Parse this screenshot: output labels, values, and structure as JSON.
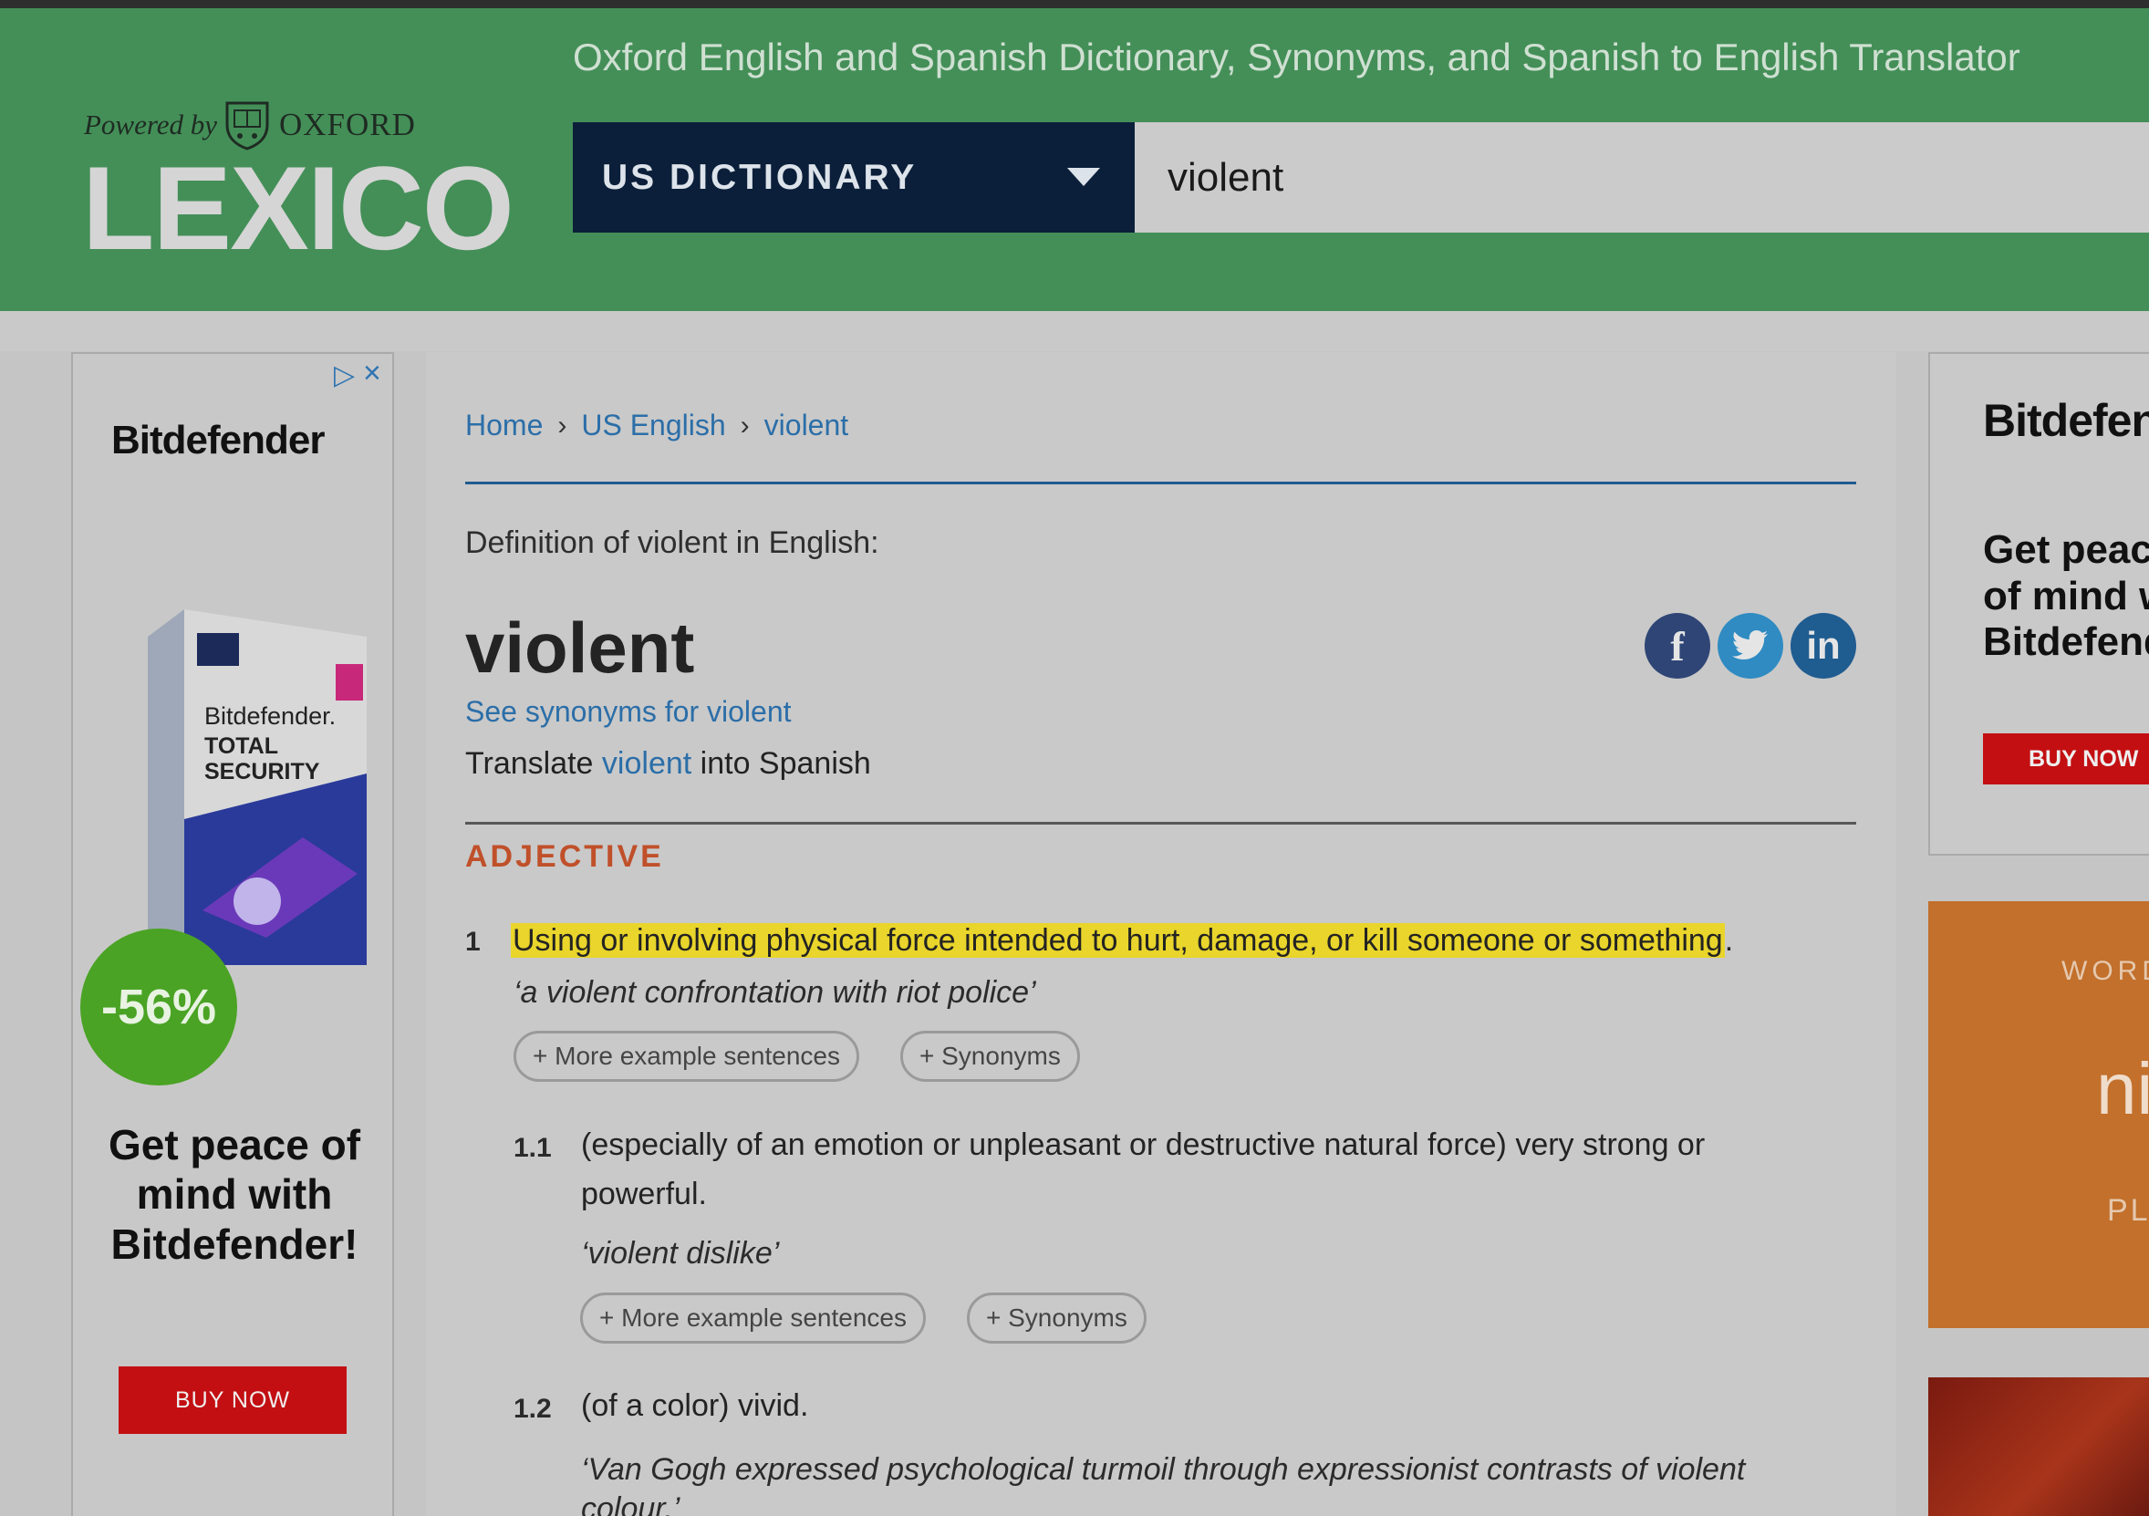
{
  "header": {
    "tagline": "Oxford English and Spanish Dictionary, Synonyms, and Spanish to English Translator",
    "powered_by": "Powered by",
    "oxford": "OXFORD",
    "logo": "LEXICO",
    "dictionary_select": "US DICTIONARY",
    "search_value": "violent"
  },
  "left_ad": {
    "brand": "Bitdefender",
    "discount": "-56%",
    "headline": "Get peace of mind with Bitdefender!",
    "button": "BUY NOW"
  },
  "breadcrumb": {
    "home": "Home",
    "section": "US English",
    "current": "violent"
  },
  "entry": {
    "definition_of": "Definition of violent in English:",
    "headword": "violent",
    "see_synonyms": "See synonyms for violent",
    "translate_prefix": "Translate",
    "translate_word": "violent",
    "translate_suffix": "into Spanish",
    "part_of_speech": "ADJECTIVE",
    "senses": [
      {
        "num": "1",
        "definition": "Using or involving physical force intended to hurt, damage, or kill someone or something",
        "example": "‘a violent confrontation with riot police’",
        "more_examples": "+ More example sentences",
        "synonyms": "+ Synonyms"
      },
      {
        "num": "1.1",
        "definition": "(especially of an emotion or unpleasant or destructive natural force) very strong or powerful.",
        "example": "‘violent dislike’",
        "more_examples": "+ More example sentences",
        "synonyms": "+ Synonyms"
      },
      {
        "num": "1.2",
        "definition": "(of a color) vivid.",
        "example": "‘Van Gogh expressed psychological turmoil through expressionist contrasts of violent colour.’"
      }
    ]
  },
  "right_ad": {
    "brand": "Bitdefender",
    "headline_1": "Get peace",
    "headline_2": "of mind with",
    "headline_3": "Bitdefender!",
    "button": "BUY NOW"
  },
  "wotd": {
    "label": "WORD OF THE DAY",
    "word": "nimbus",
    "play": "PLAY"
  },
  "colors": {
    "header_green": "#448f58",
    "select_navy": "#0b1f3a",
    "link_blue": "#2b6ea8",
    "pos_orange": "#c0502a",
    "highlight": "#e9d52b"
  }
}
